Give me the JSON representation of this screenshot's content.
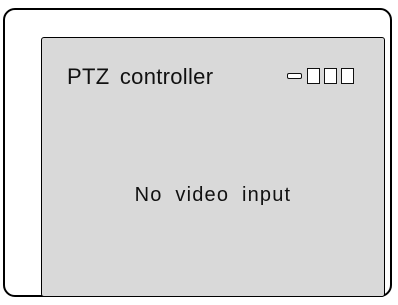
{
  "screen": {
    "title": "PTZ controller",
    "message": "No video input",
    "indicators": [
      "dash-indicator",
      "box-indicator",
      "box-indicator",
      "box-indicator"
    ]
  }
}
